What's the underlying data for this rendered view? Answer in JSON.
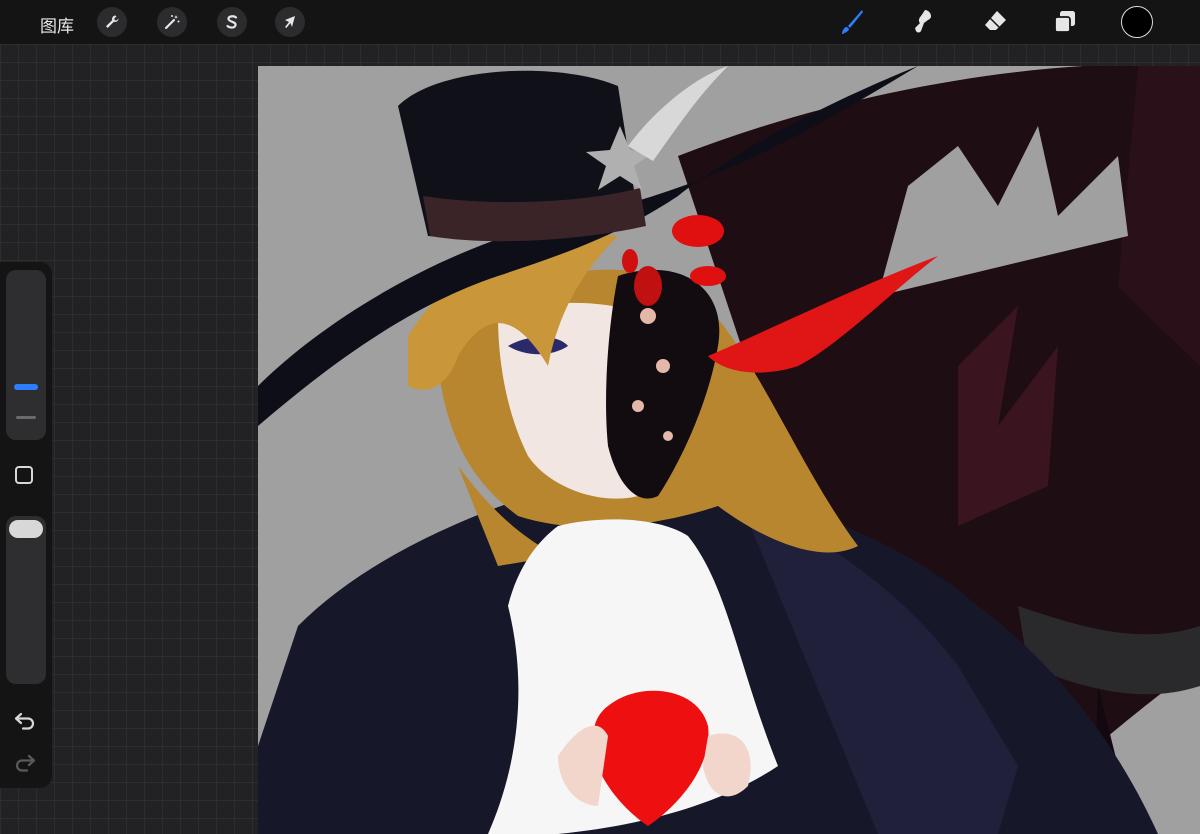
{
  "topbar": {
    "gallery_label": "图库",
    "left_tools": [
      {
        "icon": "wrench-icon",
        "name": "actions"
      },
      {
        "icon": "magic-wand-icon",
        "name": "adjustments"
      },
      {
        "icon": "selection-s-icon",
        "name": "selection"
      },
      {
        "icon": "arrow-cursor-icon",
        "name": "transform"
      }
    ],
    "right_tools": [
      {
        "icon": "brush-icon",
        "name": "paint",
        "active": true
      },
      {
        "icon": "smudge-icon",
        "name": "smudge",
        "active": false
      },
      {
        "icon": "eraser-icon",
        "name": "erase",
        "active": false
      },
      {
        "icon": "layers-icon",
        "name": "layers",
        "active": false
      }
    ],
    "current_color": "#000000"
  },
  "sidebar": {
    "brush_size_icon": "size-slider",
    "opacity_icon": "opacity-slider",
    "modify_icon": "square-icon",
    "undo_icon": "undo-icon",
    "redo_icon": "redo-icon"
  },
  "theme": {
    "accent": "#2b7fff",
    "canvas_bg": "#a0a0a0"
  }
}
